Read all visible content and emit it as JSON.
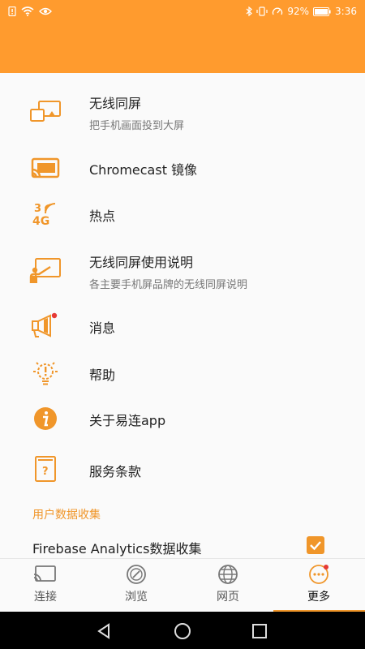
{
  "status_bar": {
    "battery": "92%",
    "time": "3:36"
  },
  "menu": {
    "items": [
      {
        "title": "无线同屏",
        "subtitle": "把手机画面投到大屏"
      },
      {
        "title": "Chromecast 镜像",
        "subtitle": ""
      },
      {
        "title": "热点",
        "subtitle": ""
      },
      {
        "title": "无线同屏使用说明",
        "subtitle": "各主要手机屏品牌的无线同屏说明"
      },
      {
        "title": "消息",
        "subtitle": ""
      },
      {
        "title": "帮助",
        "subtitle": ""
      },
      {
        "title": "关于易连app",
        "subtitle": ""
      },
      {
        "title": "服务条款",
        "subtitle": ""
      }
    ],
    "section_label": "用户数据收集",
    "firebase_label": "Firebase Analytics数据收集",
    "firebase_checked": true,
    "hotspot_icon_text_top": "3",
    "hotspot_icon_text_bottom": "4G"
  },
  "tabs": [
    {
      "label": "连接",
      "icon": "cast-icon"
    },
    {
      "label": "浏览",
      "icon": "compass-icon"
    },
    {
      "label": "网页",
      "icon": "globe-icon"
    },
    {
      "label": "更多",
      "icon": "more-icon"
    }
  ],
  "active_tab": "更多",
  "colors": {
    "accent": "#ff9b2e",
    "icon_orange": "#f0962a",
    "badge_red": "#e53935"
  }
}
